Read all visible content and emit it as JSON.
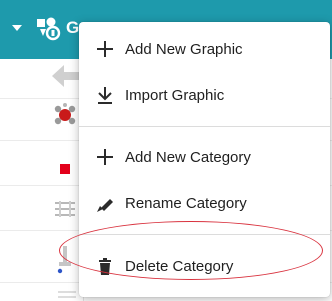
{
  "header": {
    "node_label": "G",
    "caret_icon": "caret-down-icon",
    "node_icon": "shapes-cluster-icon"
  },
  "context_menu": {
    "items": [
      {
        "label": "Add New Graphic",
        "icon": "plus-icon"
      },
      {
        "label": "Import Graphic",
        "icon": "download-icon"
      },
      {
        "label": "Add New Category",
        "icon": "plus-icon"
      },
      {
        "label": "Rename Category",
        "icon": "pencil-icon"
      },
      {
        "label": "Delete Category",
        "icon": "trash-icon"
      }
    ]
  },
  "colors": {
    "header_bg": "#1e9aac",
    "highlight": "#d9333f",
    "status_red": "#e3001b"
  }
}
